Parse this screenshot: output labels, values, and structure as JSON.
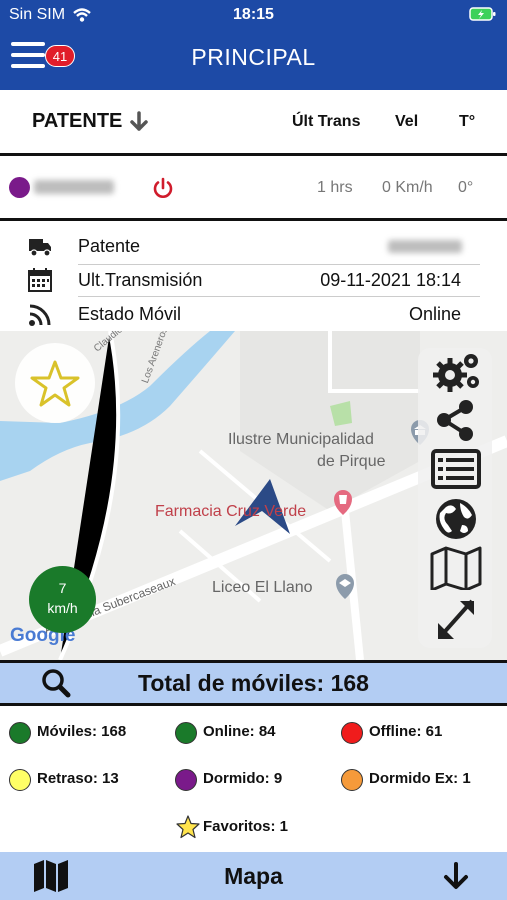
{
  "status_bar": {
    "carrier": "Sin SIM",
    "time": "18:15"
  },
  "nav": {
    "title": "PRINCIPAL",
    "badge_count": "41"
  },
  "list_header": {
    "patente": "PATENTE",
    "ult_trans": "Últ Trans",
    "vel": "Vel",
    "temp": "T°"
  },
  "vehicle": {
    "last_trans": "1 hrs",
    "speed": "0 Km/h",
    "temp": "0°",
    "status_color": "#7a1a8a"
  },
  "details": [
    {
      "icon": "truck-icon",
      "label": "Patente",
      "value": ""
    },
    {
      "icon": "calendar-icon",
      "label": "Ult.Transmisión",
      "value": "09-11-2021 18:14"
    },
    {
      "icon": "rss-icon",
      "label": "Estado Móvil",
      "value": "Online"
    }
  ],
  "map": {
    "labels": {
      "municipalidad_1": "Ilustre Municipalidad",
      "municipalidad_2": "de Pirque",
      "farmacia": "Farmacia Cruz Verde",
      "liceo": "Liceo El Llano",
      "street_main": "Av. Virginia Subercaseaux",
      "street_arenero": "Los Areneros",
      "street_claudio": "Claudio",
      "google": "Google"
    },
    "speed": {
      "value": "7",
      "unit": "km/h"
    },
    "tools": [
      "settings-icon",
      "share-icon",
      "list-icon",
      "globe-icon",
      "map-icon",
      "expand-icon"
    ]
  },
  "totals": {
    "text": "Total de móviles: 168"
  },
  "legend": [
    {
      "label": "Móviles: 168",
      "color": "#1a7a2a"
    },
    {
      "label": "Online: 84",
      "color": "#1a7a2a"
    },
    {
      "label": "Offline: 61",
      "color": "#f01c1c"
    },
    {
      "label": "Retraso: 13",
      "color": "#ffff66"
    },
    {
      "label": "Dormido: 9",
      "color": "#7a1a8a"
    },
    {
      "label": "Dormido Ex: 1",
      "color": "#f59a3a"
    },
    {
      "label": "Favoritos: 1",
      "color": "#ffe44d"
    }
  ],
  "bottom": {
    "label": "Mapa"
  }
}
